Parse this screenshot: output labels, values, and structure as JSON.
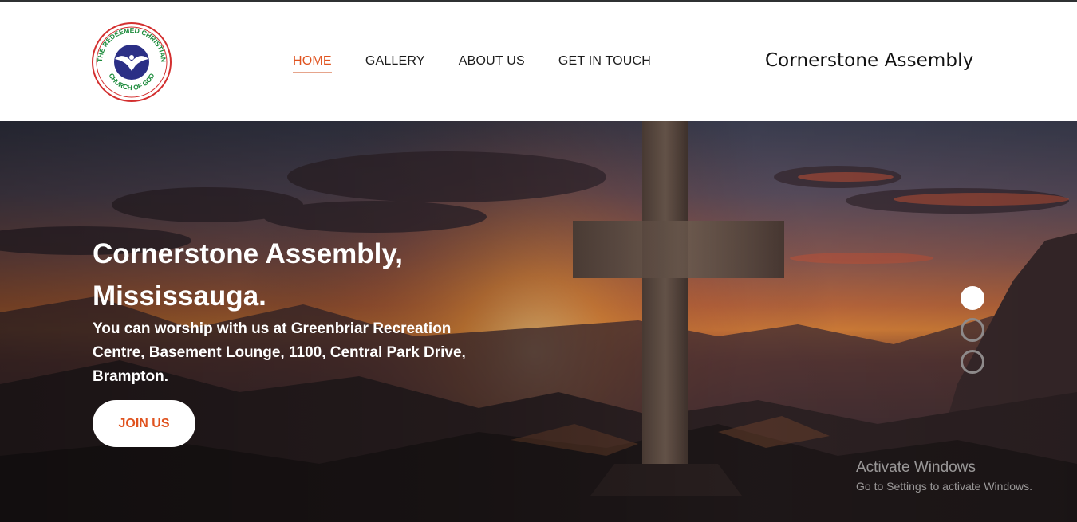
{
  "logo": {
    "ring_text_top": "THE REDEEMED CHRISTIAN",
    "ring_text_bottom": "CHURCH OF GOD"
  },
  "nav": {
    "items": [
      {
        "label": "HOME",
        "active": true
      },
      {
        "label": "GALLERY",
        "active": false
      },
      {
        "label": "ABOUT US",
        "active": false
      },
      {
        "label": "GET IN TOUCH",
        "active": false
      }
    ]
  },
  "brand": "Cornerstone Assembly",
  "hero": {
    "title": "Cornerstone Assembly, Mississauga.",
    "text": "You can worship with us at Greenbriar Recreation Centre, Basement Lounge, 1100, Central Park Drive, Brampton.",
    "button": "JOIN US",
    "slides": [
      {
        "active": true
      },
      {
        "active": false
      },
      {
        "active": false
      }
    ]
  },
  "watermark": {
    "line1": "Activate Windows",
    "line2": "Go to Settings to activate Windows."
  },
  "colors": {
    "accent": "#e0531f",
    "logo_blue": "#2b2f86",
    "logo_green": "#1a8a3a",
    "logo_red": "#d32f2f"
  }
}
